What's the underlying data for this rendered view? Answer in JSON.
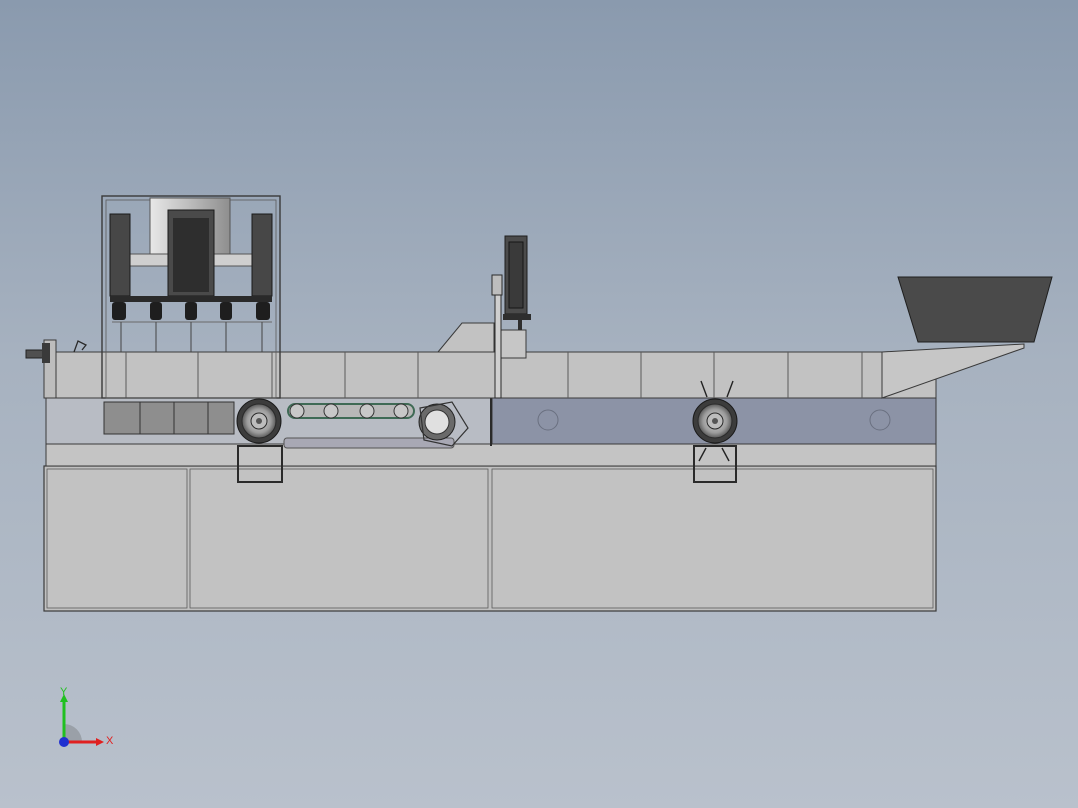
{
  "viewport": {
    "background_top": "#8a9aae",
    "background_bottom": "#b9c1cc"
  },
  "colors": {
    "body_fill": "#c0c0c0",
    "edge": "#3a3a3a",
    "conveyor_blue": "#8c93a6",
    "hopper_dark": "#4a4a4a",
    "motor_dark": "#3c3c3c",
    "chain_green": "#3f6a55"
  },
  "triad": {
    "x_label": "X",
    "y_label": "Y",
    "x_color": "#e02020",
    "y_color": "#20c020",
    "z_color": "#2030d0"
  }
}
